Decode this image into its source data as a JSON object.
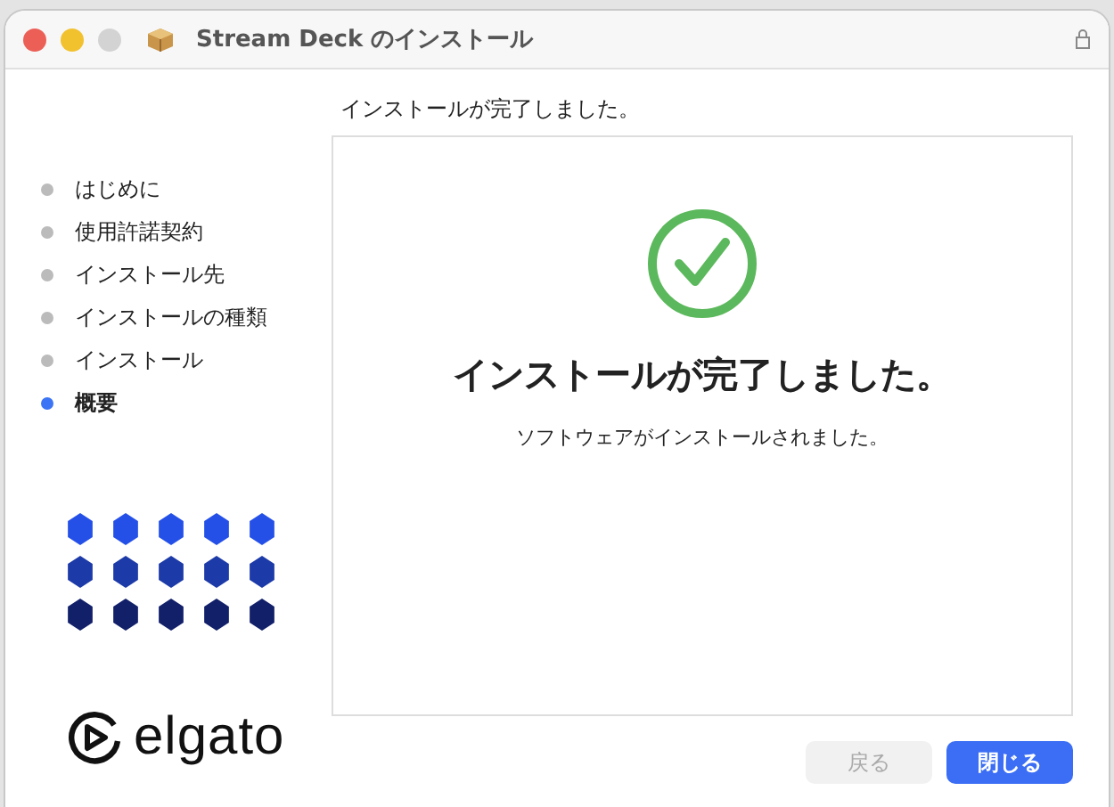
{
  "window": {
    "title": "Stream Deck のインストール"
  },
  "steps": [
    {
      "label": "はじめに",
      "selected": false
    },
    {
      "label": "使用許諾契約",
      "selected": false
    },
    {
      "label": "インストール先",
      "selected": false
    },
    {
      "label": "インストールの種類",
      "selected": false
    },
    {
      "label": "インストール",
      "selected": false
    },
    {
      "label": "概要",
      "selected": true
    }
  ],
  "logo": {
    "text": "elgato"
  },
  "heading": "インストールが完了しました。",
  "panel": {
    "title": "インストールが完了しました。",
    "message": "ソフトウェアがインストールされました。"
  },
  "buttons": [
    {
      "label": "戻る",
      "disabled": true,
      "kind": "secondary"
    },
    {
      "label": "閉じる",
      "disabled": false,
      "kind": "primary"
    }
  ]
}
